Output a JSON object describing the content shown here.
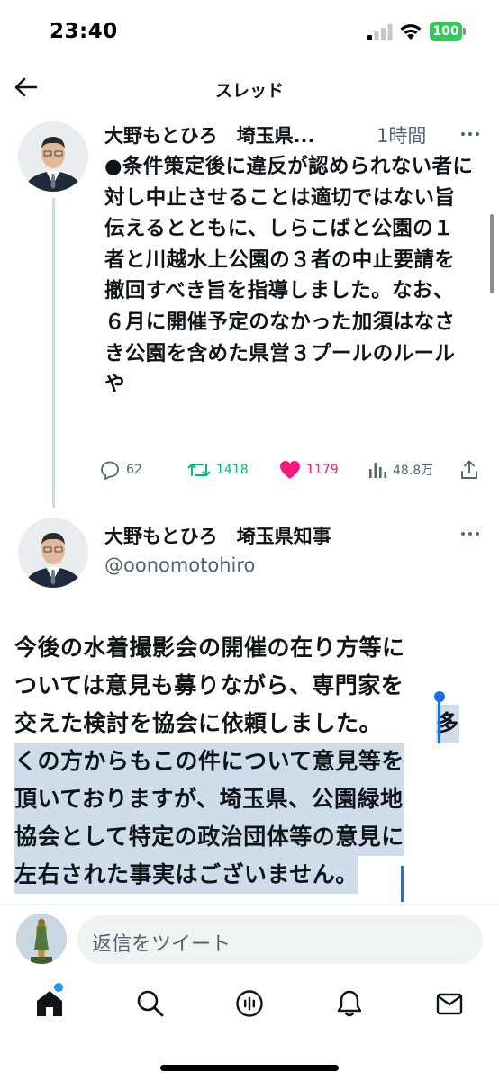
{
  "status_bar": {
    "time": "23:40",
    "battery": "100"
  },
  "header": {
    "title": "スレッド"
  },
  "tweet1": {
    "name": "大野もとひろ　埼玉県...",
    "time": "1時間",
    "text": "●条件策定後に違反が認められない者に対し中止させることは適切ではない旨伝えるとともに、しらこばと公園の１者と川越水上公園の３者の中止要請を撤回すべき旨を指導しました。なお、６月に開催予定のなかった加須はなさき公園を含めた県営３プールのルールや",
    "replies": "62",
    "retweets": "1418",
    "likes": "1179",
    "views": "48.8万"
  },
  "tweet2": {
    "name": "大野もとひろ　埼玉県知事",
    "handle": "@oonomotohiro",
    "lines": [
      "今後の水着撮影会の開催の在り方等に",
      "ついては意見も募りながら、専門家を",
      "交えた検討を協会に依頼しました。",
      "多",
      "くの方からもこの件について意見等を",
      "頂いておりますが、埼玉県、公園緑地",
      "協会として特定の政治団体等の意見に",
      "左右された事実はございません。"
    ]
  },
  "reply_bar": {
    "placeholder": "返信をツイート"
  },
  "colors": {
    "retweet": "#00ba7c",
    "like": "#f91880",
    "accent": "#1d9bf0",
    "selection": "#cfdcea",
    "secondary_text": "#536471"
  },
  "icons": [
    "back-arrow-icon",
    "more-icon",
    "reply-icon",
    "retweet-icon",
    "heart-icon",
    "views-icon",
    "share-icon",
    "home-icon",
    "search-icon",
    "spaces-icon",
    "bell-icon",
    "mail-icon"
  ]
}
